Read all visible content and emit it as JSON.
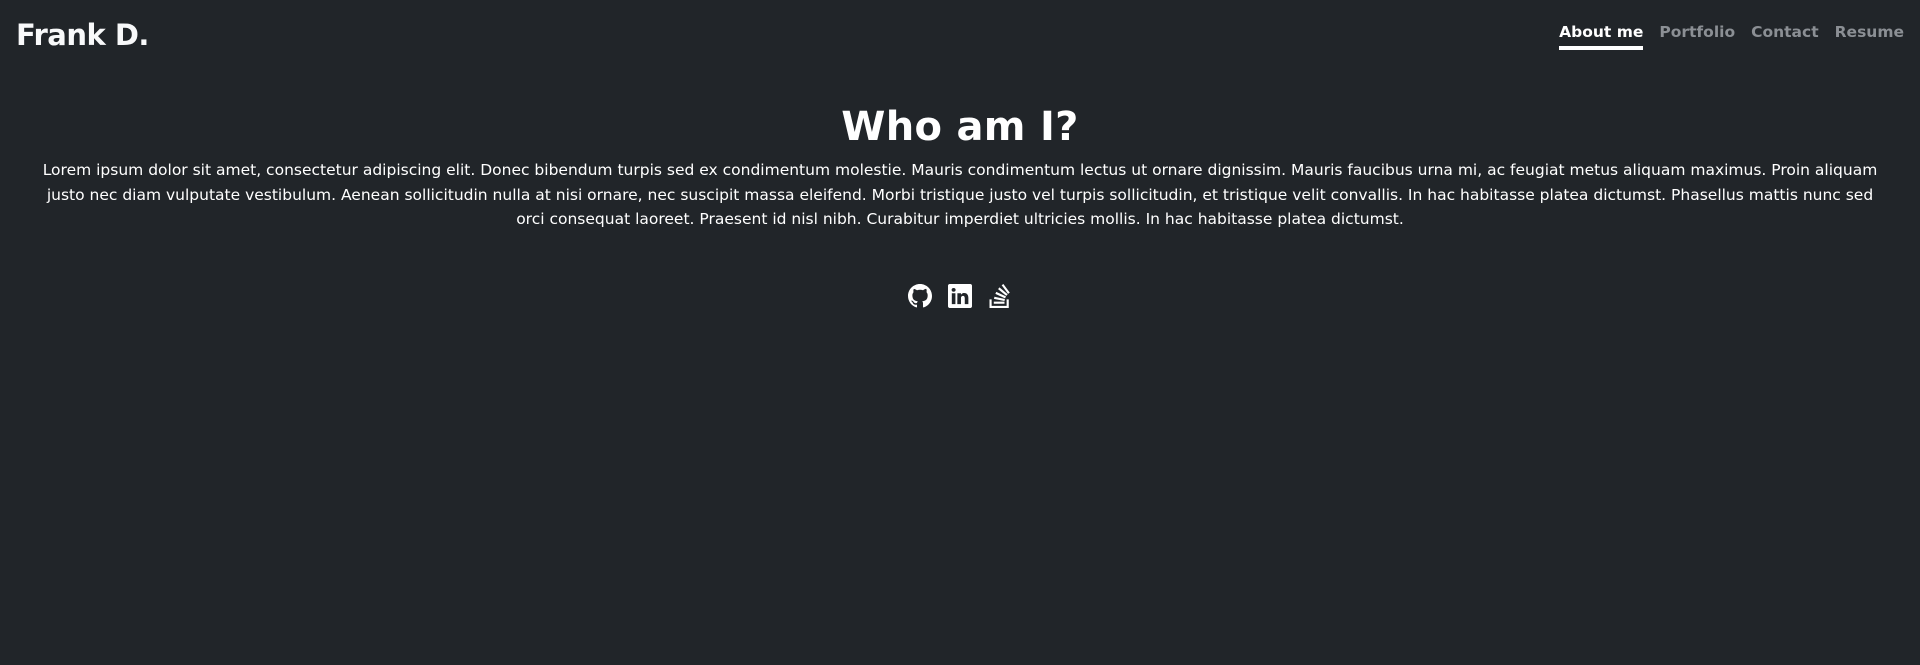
{
  "header": {
    "brand": "Frank D.",
    "nav": [
      {
        "label": "About me",
        "active": true
      },
      {
        "label": "Portfolio",
        "active": false
      },
      {
        "label": "Contact",
        "active": false
      },
      {
        "label": "Resume",
        "active": false
      }
    ]
  },
  "main": {
    "title": "Who am I?",
    "bio": "Lorem ipsum dolor sit amet, consectetur adipiscing elit. Donec bibendum turpis sed ex condimentum molestie. Mauris condimentum lectus ut ornare dignissim. Mauris faucibus urna mi, ac feugiat metus aliquam maximus. Proin aliquam justo nec diam vulputate vestibulum. Aenean sollicitudin nulla at nisi ornare, nec suscipit massa eleifend. Morbi tristique justo vel turpis sollicitudin, et tristique velit convallis. In hac habitasse platea dictumst. Phasellus mattis nunc sed orci consequat laoreet. Praesent id nisl nibh. Curabitur imperdiet ultricies mollis. In hac habitasse platea dictumst."
  },
  "social": [
    {
      "icon": "github-icon"
    },
    {
      "icon": "linkedin-icon"
    },
    {
      "icon": "stackoverflow-icon"
    }
  ],
  "colors": {
    "background": "#212529",
    "text": "#ffffff",
    "nav_inactive": "#8b8f94"
  }
}
